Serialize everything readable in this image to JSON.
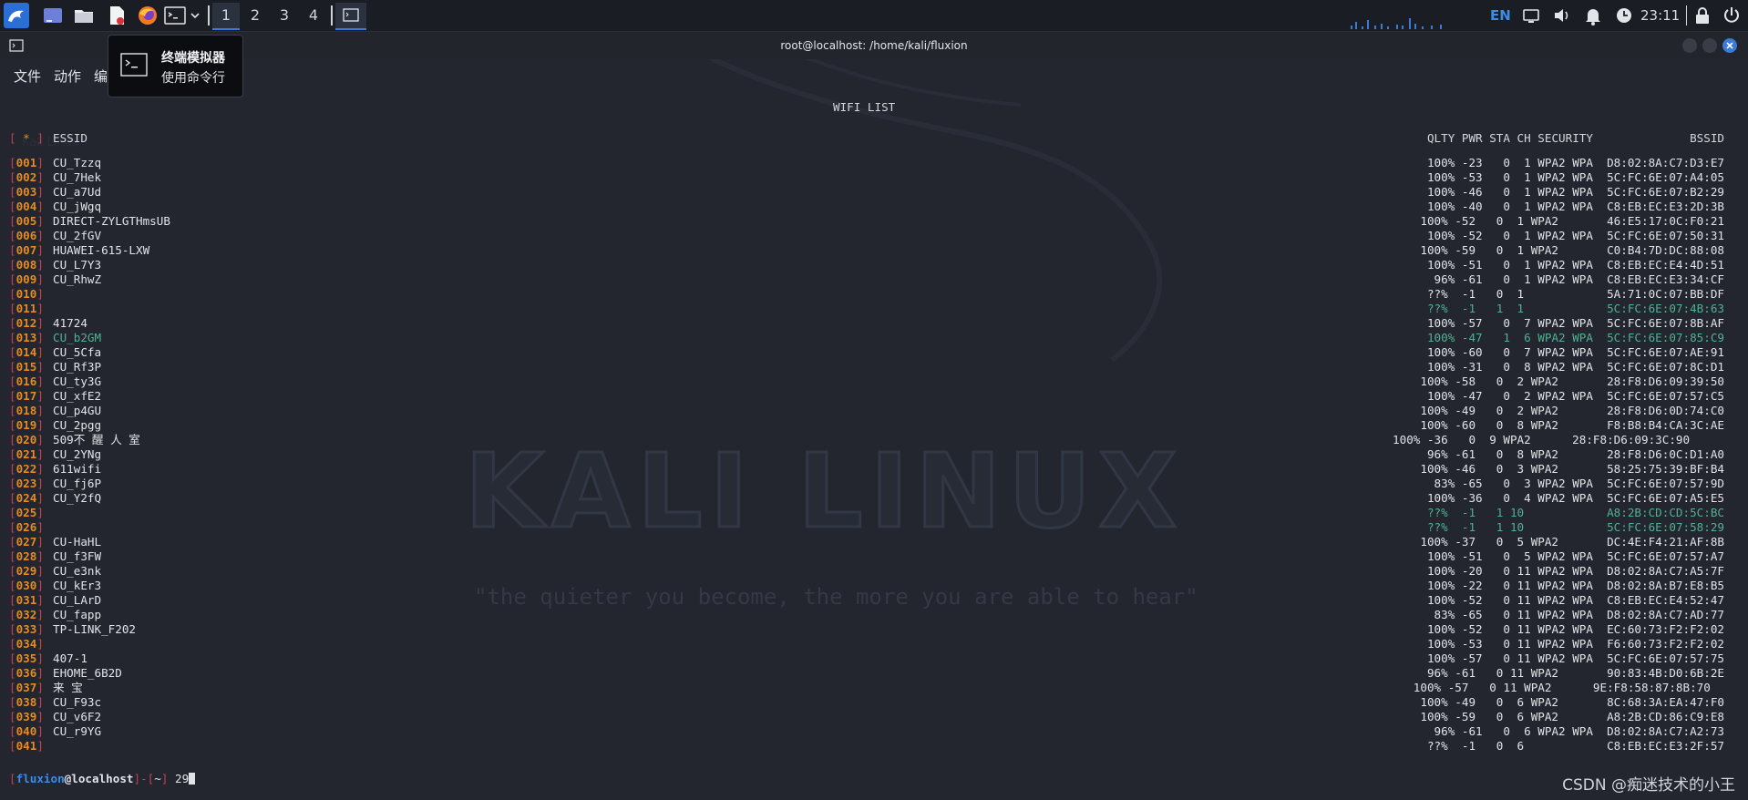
{
  "taskbar": {
    "workspaces": [
      "1",
      "2",
      "3",
      "4"
    ],
    "active_workspace": 0,
    "lang": "EN",
    "clock": "23:11"
  },
  "window": {
    "title": "root@localhost: /home/kali/fluxion",
    "menus": [
      "文件",
      "动作",
      "编"
    ]
  },
  "tooltip": {
    "title": "终端模拟器",
    "subtitle": "使用命令行"
  },
  "watermark": {
    "logo": "KALI LINUX",
    "quote": "\"the quieter you become, the more you are able to hear\""
  },
  "terminal": {
    "heading": "WIFI LIST",
    "header_marker": "*",
    "header_essid": "ESSID",
    "header_cols": "QLTY PWR STA CH SECURITY              BSSID",
    "rows": [
      {
        "idx": "001",
        "essid": "CU_Tzzq",
        "stats": "100% -23   0  1 WPA2 WPA  D8:02:8A:C7:D3:E7",
        "green": false
      },
      {
        "idx": "002",
        "essid": "CU_7Hek",
        "stats": "100% -53   0  1 WPA2 WPA  5C:FC:6E:07:A4:05",
        "green": false
      },
      {
        "idx": "003",
        "essid": "CU_a7Ud",
        "stats": "100% -46   0  1 WPA2 WPA  5C:FC:6E:07:B2:29",
        "green": false
      },
      {
        "idx": "004",
        "essid": "CU_jWgq",
        "stats": "100% -40   0  1 WPA2 WPA  C8:EB:EC:E3:2D:3B",
        "green": false
      },
      {
        "idx": "005",
        "essid": "DIRECT-ZYLGTHmsUB",
        "stats": "100% -52   0  1 WPA2       46:E5:17:0C:F0:21",
        "green": false
      },
      {
        "idx": "006",
        "essid": "CU_2fGV",
        "stats": "100% -52   0  1 WPA2 WPA  5C:FC:6E:07:50:31",
        "green": false
      },
      {
        "idx": "007",
        "essid": "HUAWEI-615-LXW",
        "stats": "100% -59   0  1 WPA2       C0:B4:7D:DC:88:08",
        "green": false
      },
      {
        "idx": "008",
        "essid": "CU_L7Y3",
        "stats": "100% -51   0  1 WPA2 WPA  C8:EB:EC:E4:4D:51",
        "green": false
      },
      {
        "idx": "009",
        "essid": "CU_RhwZ",
        "stats": " 96% -61   0  1 WPA2 WPA  C8:EB:EC:E3:34:CF",
        "green": false
      },
      {
        "idx": "010",
        "essid": "",
        "stats": " ??%  -1   0  1            5A:71:0C:07:BB:DF",
        "green": false
      },
      {
        "idx": "011",
        "essid": "",
        "stats": " ??%  -1   1  1            5C:FC:6E:07:4B:63",
        "green": true
      },
      {
        "idx": "012",
        "essid": "41724",
        "stats": "100% -57   0  7 WPA2 WPA  5C:FC:6E:07:8B:AF",
        "green": false
      },
      {
        "idx": "013",
        "essid": "CU_b2GM",
        "stats": "100% -47   1  6 WPA2 WPA  5C:FC:6E:07:85:C9",
        "green": true
      },
      {
        "idx": "014",
        "essid": "CU_5Cfa",
        "stats": "100% -60   0  7 WPA2 WPA  5C:FC:6E:07:AE:91",
        "green": false
      },
      {
        "idx": "015",
        "essid": "CU_Rf3P",
        "stats": "100% -31   0  8 WPA2 WPA  5C:FC:6E:07:8C:D1",
        "green": false
      },
      {
        "idx": "016",
        "essid": "CU_ty3G",
        "stats": "100% -58   0  2 WPA2       28:F8:D6:09:39:50",
        "green": false
      },
      {
        "idx": "017",
        "essid": "CU_xfE2",
        "stats": "100% -47   0  2 WPA2 WPA  5C:FC:6E:07:57:C5",
        "green": false
      },
      {
        "idx": "018",
        "essid": "CU_p4GU",
        "stats": "100% -49   0  2 WPA2       28:F8:D6:0D:74:C0",
        "green": false
      },
      {
        "idx": "019",
        "essid": "CU_2pgg",
        "stats": "100% -60   0  8 WPA2       F8:B8:B4:CA:3C:AE",
        "green": false
      },
      {
        "idx": "020",
        "essid": "509不 醒 人 室",
        "stats": "100% -36   0  9 WPA2      28:F8:D6:09:3C:90     ",
        "green": false
      },
      {
        "idx": "021",
        "essid": "CU_2YNg",
        "stats": " 96% -61   0  8 WPA2       28:F8:D6:0C:D1:A0",
        "green": false
      },
      {
        "idx": "022",
        "essid": "611wifi",
        "stats": "100% -46   0  3 WPA2       58:25:75:39:BF:B4",
        "green": false
      },
      {
        "idx": "023",
        "essid": "CU_fj6P",
        "stats": " 83% -65   0  3 WPA2 WPA  5C:FC:6E:07:57:9D",
        "green": false
      },
      {
        "idx": "024",
        "essid": "CU_Y2fQ",
        "stats": "100% -36   0  4 WPA2 WPA  5C:FC:6E:07:A5:E5",
        "green": false
      },
      {
        "idx": "025",
        "essid": "",
        "stats": " ??%  -1   1 10            A8:2B:CD:CD:5C:BC",
        "green": true
      },
      {
        "idx": "026",
        "essid": "",
        "stats": " ??%  -1   1 10            5C:FC:6E:07:58:29",
        "green": true
      },
      {
        "idx": "027",
        "essid": "CU-HaHL",
        "stats": "100% -37   0  5 WPA2       DC:4E:F4:21:AF:8B",
        "green": false
      },
      {
        "idx": "028",
        "essid": "CU_f3FW",
        "stats": "100% -51   0  5 WPA2 WPA  5C:FC:6E:07:57:A7",
        "green": false
      },
      {
        "idx": "029",
        "essid": "CU_e3nk",
        "stats": "100% -20   0 11 WPA2 WPA  D8:02:8A:C7:A5:7F",
        "green": false
      },
      {
        "idx": "030",
        "essid": "CU_kEr3",
        "stats": "100% -22   0 11 WPA2 WPA  D8:02:8A:B7:E8:B5",
        "green": false
      },
      {
        "idx": "031",
        "essid": "CU_LArD",
        "stats": "100% -52   0 11 WPA2 WPA  C8:EB:EC:E4:52:47",
        "green": false
      },
      {
        "idx": "032",
        "essid": "CU_fapp",
        "stats": " 83% -65   0 11 WPA2 WPA  D8:02:8A:C7:AD:77",
        "green": false
      },
      {
        "idx": "033",
        "essid": "TP-LINK_F202",
        "stats": "100% -52   0 11 WPA2 WPA  EC:60:73:F2:F2:02",
        "green": false
      },
      {
        "idx": "034",
        "essid": "",
        "stats": "100% -53   0 11 WPA2 WPA  F6:60:73:F2:F2:02",
        "green": false
      },
      {
        "idx": "035",
        "essid": "407-1",
        "stats": "100% -57   0 11 WPA2 WPA  5C:FC:6E:07:57:75",
        "green": false
      },
      {
        "idx": "036",
        "essid": "EHOME_6B2D",
        "stats": " 96% -61   0 11 WPA2       90:83:4B:D0:6B:2E",
        "green": false
      },
      {
        "idx": "037",
        "essid": "来 宝",
        "stats": "100% -57   0 11 WPA2      9E:F8:58:87:8B:70  ",
        "green": false
      },
      {
        "idx": "038",
        "essid": "CU_F93c",
        "stats": "100% -49   0  6 WPA2       8C:68:3A:EA:47:F0",
        "green": false
      },
      {
        "idx": "039",
        "essid": "CU_v6F2",
        "stats": "100% -59   0  6 WPA2       A8:2B:CD:86:C9:E8",
        "green": false
      },
      {
        "idx": "040",
        "essid": "CU_r9YG",
        "stats": " 96% -61   0  6 WPA2 WPA  D8:02:8A:C7:A2:73",
        "green": false
      },
      {
        "idx": "041",
        "essid": "",
        "stats": " ??%  -1   0  6            C8:EB:EC:E3:2F:57",
        "green": false
      }
    ],
    "prompt": {
      "user": "fluxion",
      "at": "@",
      "host": "localhost",
      "dir": "~",
      "input": "29"
    }
  },
  "overlay_watermark": "CSDN @痴迷技术的小王"
}
